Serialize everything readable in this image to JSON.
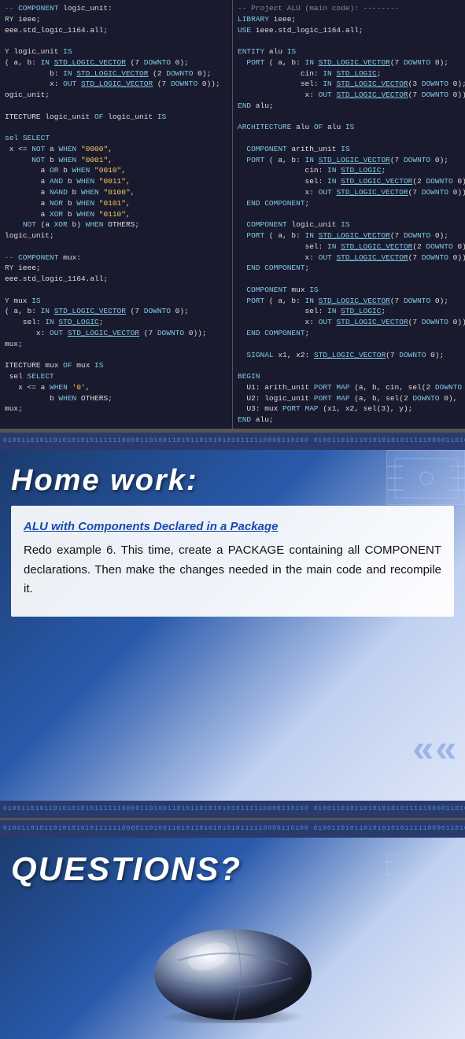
{
  "code": {
    "left_panel": "-- COMPONENT logic_unit:\nRY ieee;\neee.std_logic_1164.all;\n\nY logic_unit IS\n( a, b: IN STD_LOGIC_VECTOR (7 DOWNTO 0);\n          b: IN STD_LOGIC_VECTOR (2 DOWNTO 0);\n          x: OUT STD_LOGIC_VECTOR (7 DOWNTO 0));\nogic_unit;\n\nITECTURE logic_unit OF logic_unit IS\n\n sel SELECT\n  x <= NOT a WHEN \"0000\",\n       NOT b WHEN \"0001\",\n         a OR b WHEN \"0010\",\n         a AND b WHEN \"0011\",\n         a NAND b WHEN \"0100\",\n         a NOR b WHEN \"0101\",\n         a XOR b WHEN \"0110\",\n     NOT (a XOR b) WHEN OTHERS;\nlogic_unit;\n\n-- COMPONENT mux:\nRY ieee;\neee.std_logic_1164.all;\n\nY mux IS\n( a, b: IN STD_LOGIC_VECTOR (7 DOWNTO 0);\n    sel: IN STD_LOGIC;\n       x: OUT STD_LOGIC_VECTOR (7 DOWNTO 0));\nmux;\n\nITECTURE mux OF mux IS\n sel SELECT\n   x <= a WHEN '0',\n          b WHEN OTHERS;\nmux;",
    "right_panel": "-- Project ALU (main code): --------\nLIBRARY ieee;\nUSE ieee.std_logic_1164.all;\n\nENTITY alu IS\n  PORT ( a, b: IN STD_LOGIC_VECTOR(7 DOWNTO 0);\n              cin: IN STD_LOGIC;\n              sel: IN STD_LOGIC_VECTOR(3 DOWNTO 0);\n               x: OUT STD_LOGIC_VECTOR(7 DOWNTO 0));\nEND alu;\n\nARCHITECTURE alu OF alu IS\n\n  COMPONENT arith_unit IS\n  PORT ( a, b: IN STD_LOGIC_VECTOR(7 DOWNTO 0);\n               cin: IN STD_LOGIC;\n               sel: IN STD_LOGIC_VECTOR(2 DOWNTO 0);\n               x: OUT STD_LOGIC_VECTOR(7 DOWNTO 0));\n  END COMPONENT;\n\n  COMPONENT logic_unit IS\n  PORT ( a, b: IN STD_LOGIC_VECTOR(7 DOWNTO 0);\n               sel: IN STD_LOGIC_VECTOR(2 DOWNTO 0);\n               x: OUT STD_LOGIC_VECTOR(7 DOWNTO 0));\n  END COMPONENT;\n\n  COMPONENT mux IS\n  PORT ( a, b: IN STD_LOGIC_VECTOR(7 DOWNTO 0);\n               sel: IN STD_LOGIC;\n               x: OUT STD_LOGIC_VECTOR(7 DOWNTO 0));\n  END COMPONENT;\n\n  SIGNAL x1, x2: STD_LOGIC_VECTOR(7 DOWNTO 0);\n\nBEGIN\n  U1: arith_unit PORT MAP (a, b, cin, sel(2 DOWNTO\n  U2: logic_unit PORT MAP (a, b, sel(2 DOWNTO 0),\n  U3: mux PORT MAP (x1, x2, sel(3), y);\nEND alu;"
  },
  "binary_text": "0100110101101010101011111100001101001101011010101010111110000110100",
  "homework": {
    "title": "Home work:",
    "link_text": "ALU with Components Declared in a Package",
    "body_text": "Redo example 6. This time, create a PACKAGE containing all COMPONENT declarations. Then make the changes needed in the main code and recompile it."
  },
  "questions": {
    "title": "QUESTIONS?"
  }
}
